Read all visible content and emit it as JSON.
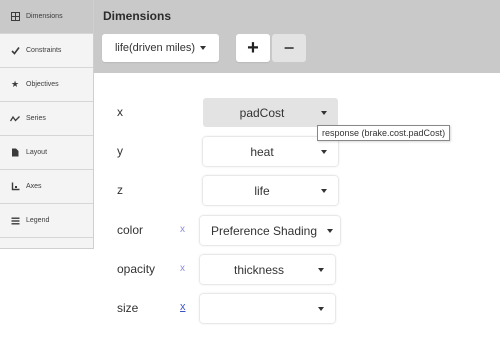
{
  "sidebar": {
    "items": [
      {
        "label": "Dimensions",
        "icon": "grid-icon",
        "active": true
      },
      {
        "label": "Constraints",
        "icon": "checkmark-icon"
      },
      {
        "label": "Objectives",
        "icon": "star-icon"
      },
      {
        "label": "Series",
        "icon": "wave-icon"
      },
      {
        "label": "Layout",
        "icon": "document-icon"
      },
      {
        "label": "Axes",
        "icon": "axes-icon"
      },
      {
        "label": "Legend",
        "icon": "list-icon"
      }
    ]
  },
  "panel": {
    "title": "Dimensions",
    "dimension_select": "life(driven miles)",
    "add_label": "+",
    "remove_label": "−"
  },
  "rows": [
    {
      "label": "x",
      "value": "padCost",
      "remove": ""
    },
    {
      "label": "y",
      "value": "heat",
      "remove": ""
    },
    {
      "label": "z",
      "value": "life",
      "remove": ""
    },
    {
      "label": "color",
      "value": "Preference Shading",
      "remove": "x"
    },
    {
      "label": "opacity",
      "value": "thickness",
      "remove": "x"
    },
    {
      "label": "size",
      "value": "",
      "remove": "x"
    }
  ],
  "tooltip": "response (brake.cost.padCost)"
}
